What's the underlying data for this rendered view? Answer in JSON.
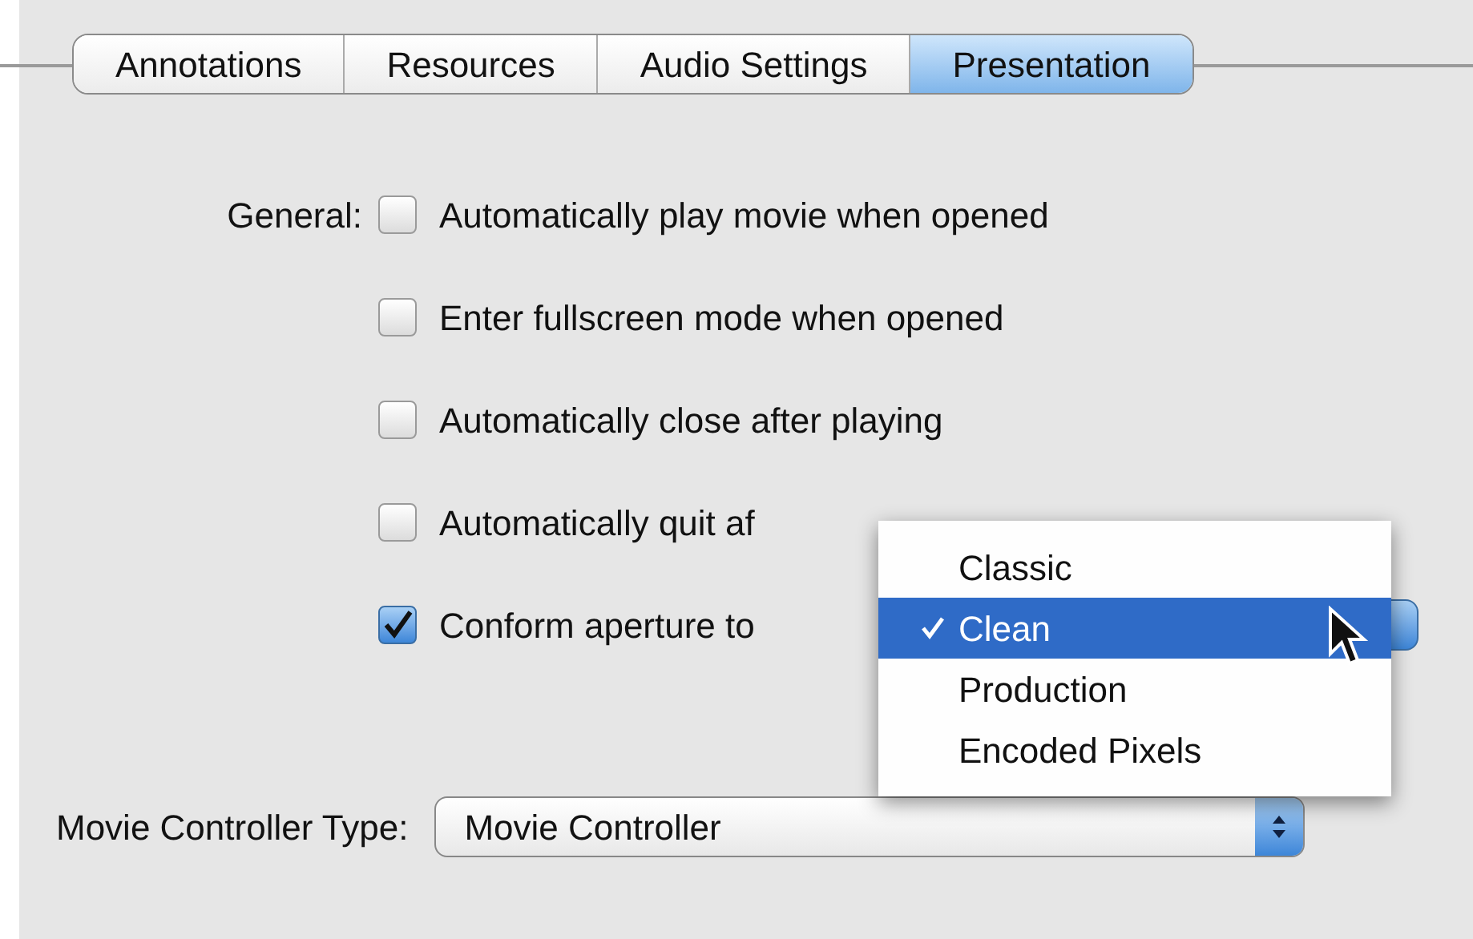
{
  "tabs": [
    {
      "label": "Annotations",
      "selected": false
    },
    {
      "label": "Resources",
      "selected": false
    },
    {
      "label": "Audio Settings",
      "selected": false
    },
    {
      "label": "Presentation",
      "selected": true
    }
  ],
  "general_label": "General:",
  "options": [
    {
      "label": "Automatically play movie when opened",
      "checked": false
    },
    {
      "label": "Enter fullscreen mode when opened",
      "checked": false
    },
    {
      "label": "Automatically close after playing",
      "checked": false
    },
    {
      "label": "Automatically quit af",
      "checked": false
    },
    {
      "label": "Conform aperture to",
      "checked": true
    }
  ],
  "aperture_menu": {
    "items": [
      {
        "label": "Classic",
        "selected": false
      },
      {
        "label": "Clean",
        "selected": true
      },
      {
        "label": "Production",
        "selected": false
      },
      {
        "label": "Encoded Pixels",
        "selected": false
      }
    ]
  },
  "controller_type": {
    "label": "Movie Controller Type:",
    "value": "Movie Controller"
  }
}
